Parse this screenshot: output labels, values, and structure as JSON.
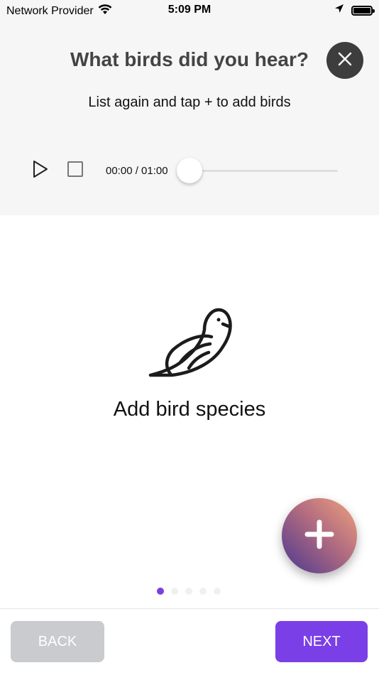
{
  "status_bar": {
    "carrier": "Network Provider",
    "time": "5:09 PM"
  },
  "header": {
    "title": "What birds did you hear?",
    "subtitle": "List again and tap + to add birds"
  },
  "player": {
    "time": "00:00 / 01:00",
    "progress": 0
  },
  "empty_state": {
    "label": "Add bird species",
    "icon": "bird-icon"
  },
  "pager": {
    "count": 5,
    "active_index": 0
  },
  "footer": {
    "back_label": "BACK",
    "next_label": "NEXT"
  },
  "colors": {
    "accent": "#7a3fe6",
    "close_bg": "#3d3d3d",
    "back_bg": "#c9cbce"
  }
}
